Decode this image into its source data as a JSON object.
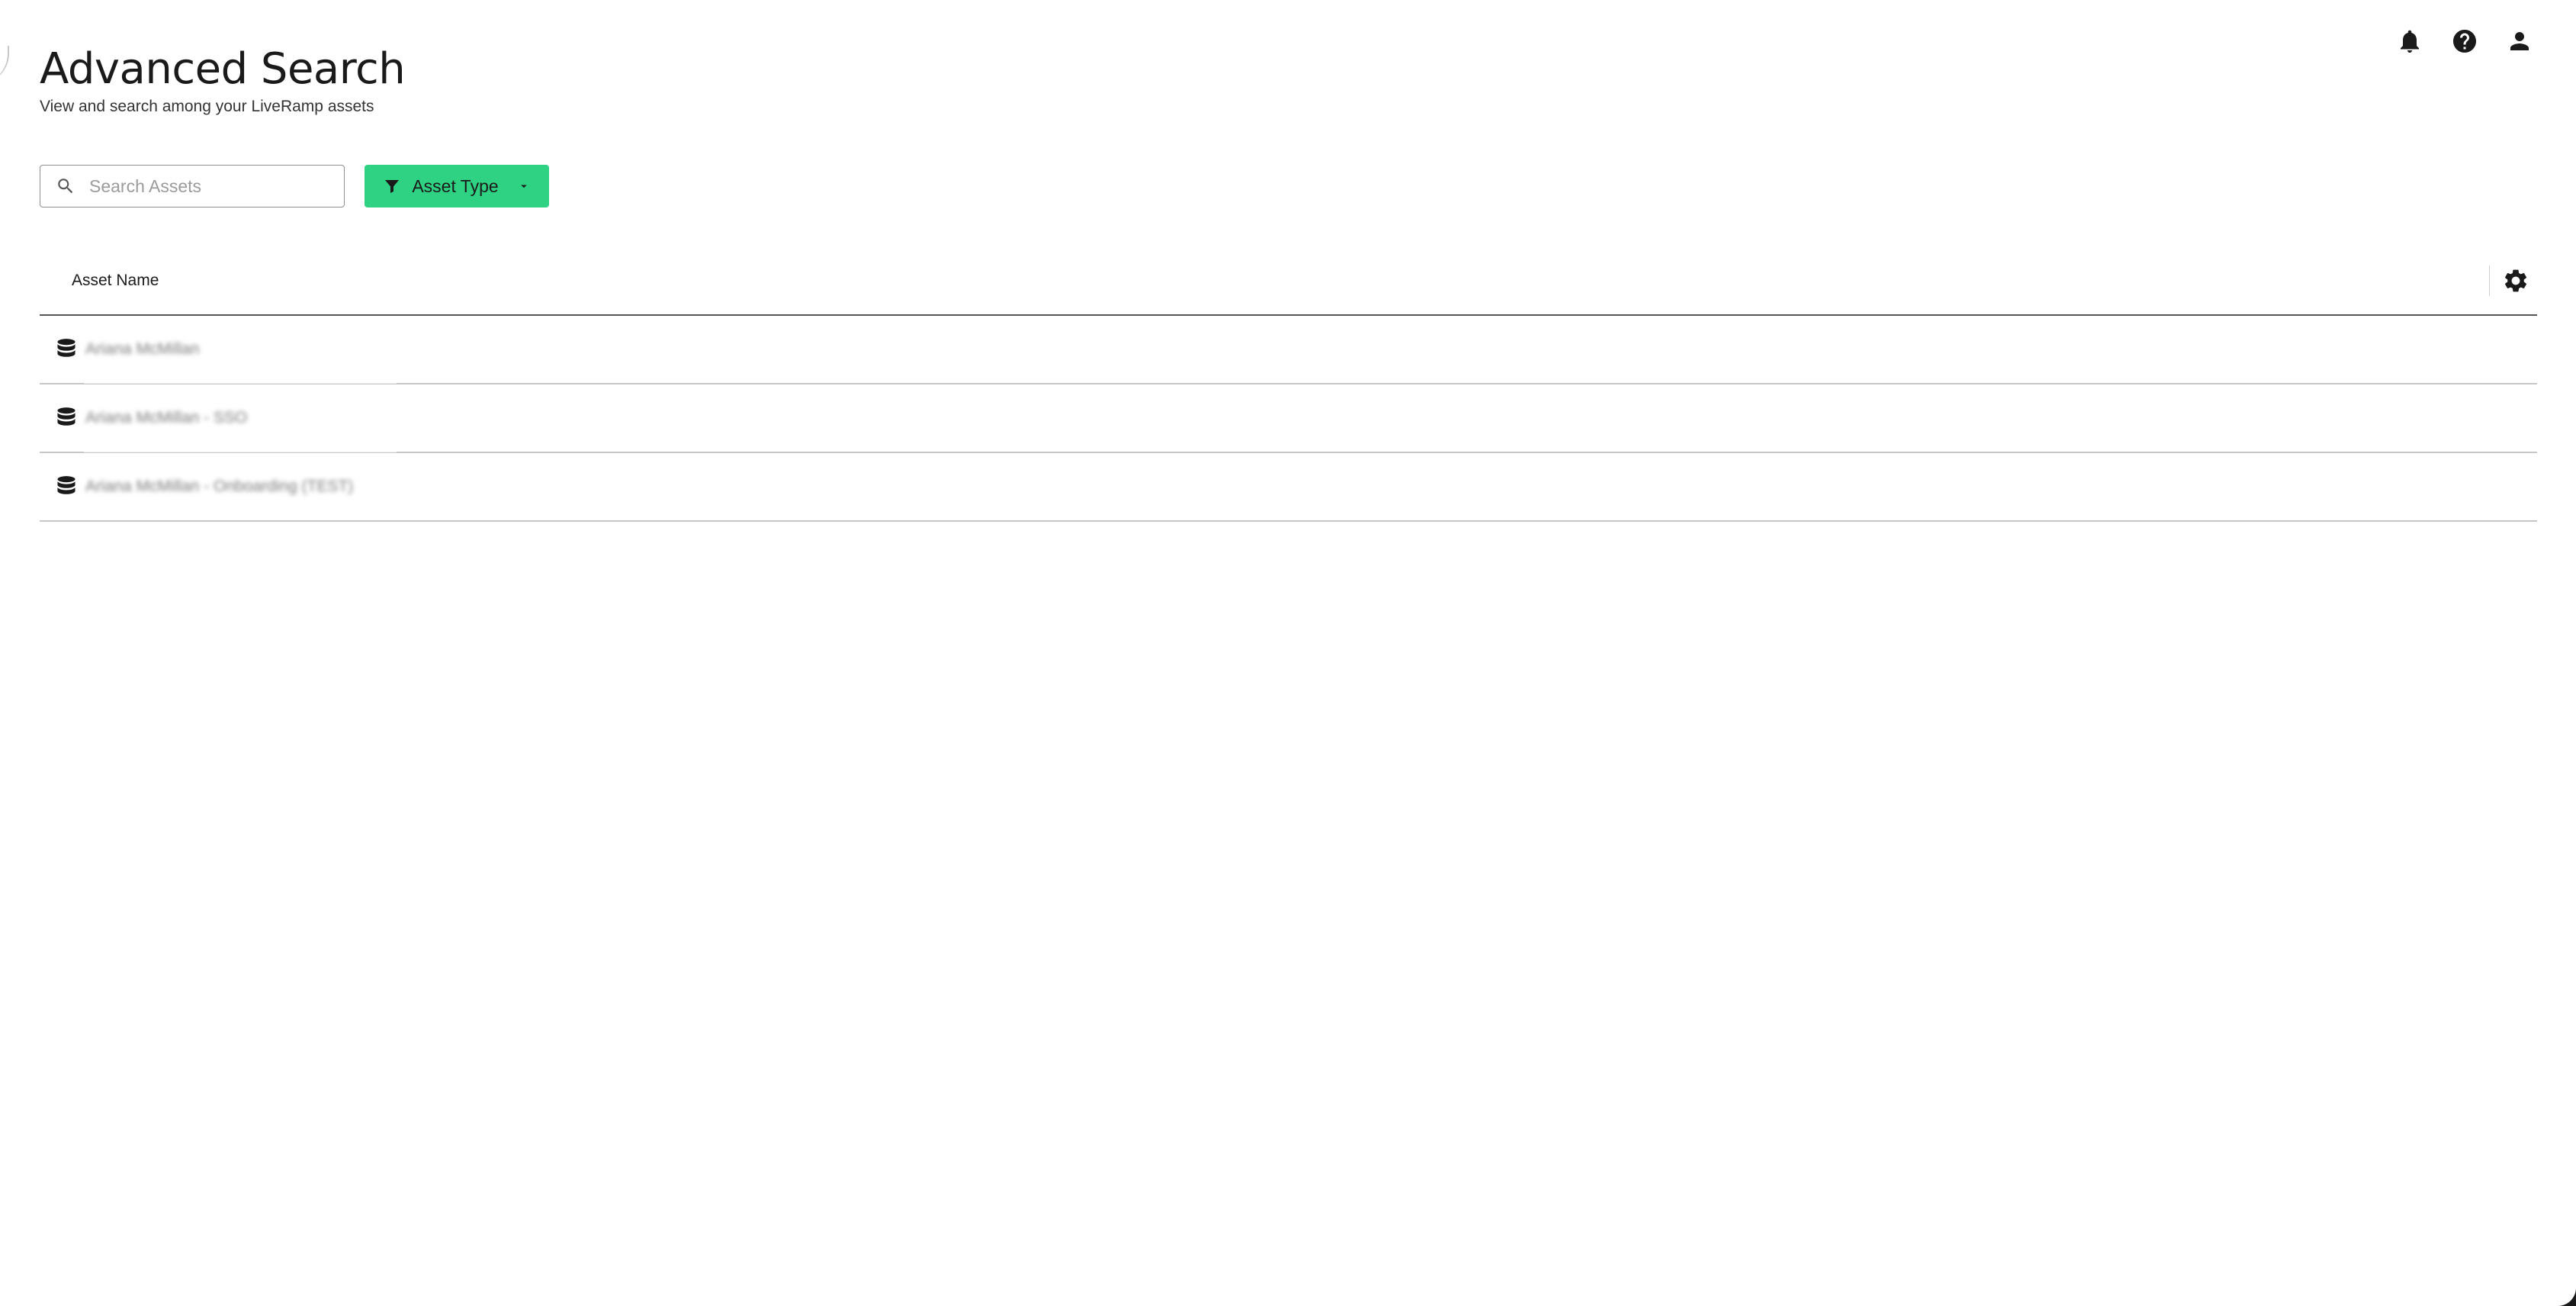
{
  "header": {
    "title": "Advanced Search",
    "subtitle": "View and search among your LiveRamp assets"
  },
  "top_icons": [
    "bell-icon",
    "help-icon",
    "user-icon"
  ],
  "search": {
    "placeholder": "Search Assets",
    "value": ""
  },
  "filter": {
    "label": "Asset Type",
    "color": "#2fd282"
  },
  "table": {
    "columns": [
      "Asset Name"
    ],
    "rows": [
      {
        "icon": "database-icon",
        "name": "Ariana McMillan"
      },
      {
        "icon": "database-icon",
        "name": "Ariana McMillan - SSO"
      },
      {
        "icon": "database-icon",
        "name": "Ariana McMillan - Onboarding (TEST)"
      }
    ]
  }
}
